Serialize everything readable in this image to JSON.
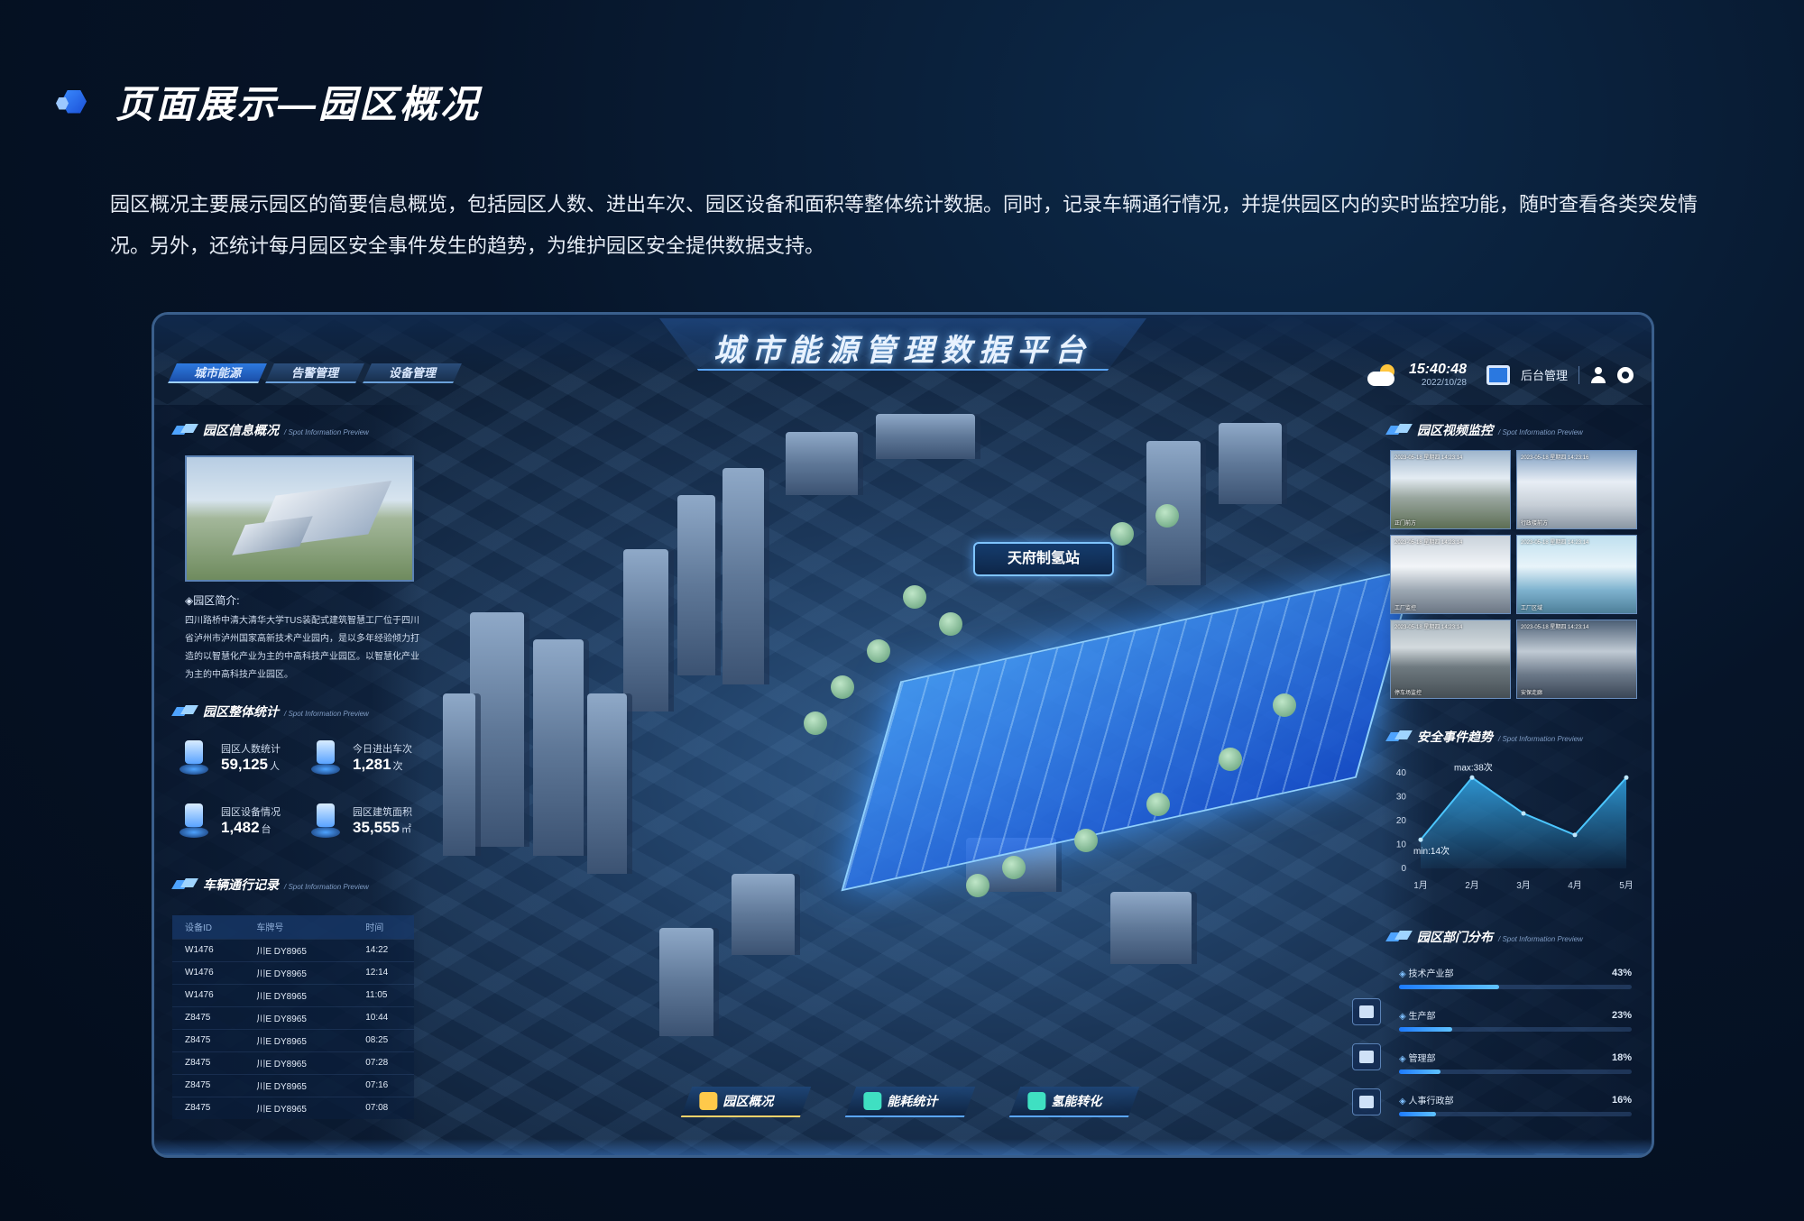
{
  "page": {
    "title": "页面展示—园区概况",
    "description": "园区概况主要展示园区的简要信息概览，包括园区人数、进出车次、园区设备和面积等整体统计数据。同时，记录车辆通行情况，并提供园区内的实时监控功能，随时查看各类突发情况。另外，还统计每月园区安全事件发生的趋势，为维护园区安全提供数据支持。"
  },
  "dashboard": {
    "title": "城市能源管理数据平台",
    "tabs": [
      {
        "label": "城市能源",
        "active": true
      },
      {
        "label": "告警管理",
        "active": false
      },
      {
        "label": "设备管理",
        "active": false
      }
    ],
    "time": "15:40:48",
    "date": "2022/10/28",
    "admin_label": "后台管理",
    "icons": {
      "weather": "partly-cloudy-icon",
      "monitor": "monitor-icon",
      "user": "user-icon",
      "settings": "settings-icon"
    }
  },
  "park_info": {
    "title": "园区信息概况",
    "subtitle": "/ Spot Information Preview",
    "intro_label": "◈园区简介:",
    "intro_text": "四川路桥中清大清华大学TUS装配式建筑智慧工厂位于四川省泸州市泸州国家高新技术产业园内，是以多年经验倾力打造的以智慧化产业为主的中高科技产业园区。以智慧化产业为主的中高科技产业园区。"
  },
  "park_stats": {
    "title": "园区整体统计",
    "subtitle": "/ Spot Information Preview",
    "items": [
      {
        "label": "园区人数统计",
        "value": "59,125",
        "unit": "人"
      },
      {
        "label": "今日进出车次",
        "value": "1,281",
        "unit": "次"
      },
      {
        "label": "园区设备情况",
        "value": "1,482",
        "unit": "台"
      },
      {
        "label": "园区建筑面积",
        "value": "35,555",
        "unit": "㎡"
      }
    ]
  },
  "vehicle_log": {
    "title": "车辆通行记录",
    "subtitle": "/ Spot Information Preview",
    "columns": [
      "设备ID",
      "车牌号",
      "时间"
    ],
    "rows": [
      [
        "W1476",
        "川E DY8965",
        "14:22"
      ],
      [
        "W1476",
        "川E DY8965",
        "12:14"
      ],
      [
        "W1476",
        "川E DY8965",
        "11:05"
      ],
      [
        "Z8475",
        "川E DY8965",
        "10:44"
      ],
      [
        "Z8475",
        "川E DY8965",
        "08:25"
      ],
      [
        "Z8475",
        "川E DY8965",
        "07:28"
      ],
      [
        "Z8475",
        "川E DY8965",
        "07:16"
      ],
      [
        "Z8475",
        "川E DY8965",
        "07:08"
      ]
    ]
  },
  "map": {
    "site_label": "天府制氢站"
  },
  "video_monitor": {
    "title": "园区视频监控",
    "subtitle": "/ Spot Information Preview",
    "cameras": [
      {
        "timestamp": "2023-05-18 星期四 14:23:14",
        "name": "正门前方"
      },
      {
        "timestamp": "2023-05-18 星期四 14:23:16",
        "name": "行政楼前方"
      },
      {
        "timestamp": "2023-05-18 星期四 14:23:14",
        "name": "工厂监控"
      },
      {
        "timestamp": "2023-05-18 星期四 14:23:14",
        "name": "工厂区域"
      },
      {
        "timestamp": "2023-05-18 星期四 14:23:14",
        "name": "停车场监控"
      },
      {
        "timestamp": "2023-05-18 星期四 14:23:14",
        "name": "安保走廊"
      }
    ]
  },
  "safety_trend": {
    "title": "安全事件趋势",
    "subtitle": "/ Spot Information Preview",
    "max_label": "max:38次",
    "min_label": "min:14次"
  },
  "chart_data": {
    "type": "area",
    "categories": [
      "1月",
      "2月",
      "3月",
      "4月",
      "5月"
    ],
    "values": [
      12,
      38,
      23,
      14,
      38
    ],
    "yticks": [
      0,
      10,
      20,
      30,
      40
    ],
    "ylim": [
      0,
      40
    ],
    "grid": false,
    "color": "#37b8ff"
  },
  "departments": {
    "title": "园区部门分布",
    "subtitle": "/ Spot Information Preview",
    "items": [
      {
        "name": "技术产业部",
        "pct": "43%",
        "value": 43
      },
      {
        "name": "生产部",
        "pct": "23%",
        "value": 23
      },
      {
        "name": "管理部",
        "pct": "18%",
        "value": 18
      },
      {
        "name": "人事行政部",
        "pct": "16%",
        "value": 16
      }
    ]
  },
  "bottom_nav": [
    {
      "label": "园区概况",
      "icon": "home-icon",
      "active": true,
      "color": "#ffc94a"
    },
    {
      "label": "能耗统计",
      "icon": "energy-icon",
      "active": false,
      "color": "#3fe0c2"
    },
    {
      "label": "氢能转化",
      "icon": "cube-icon",
      "active": false,
      "color": "#3fe0c2"
    }
  ]
}
